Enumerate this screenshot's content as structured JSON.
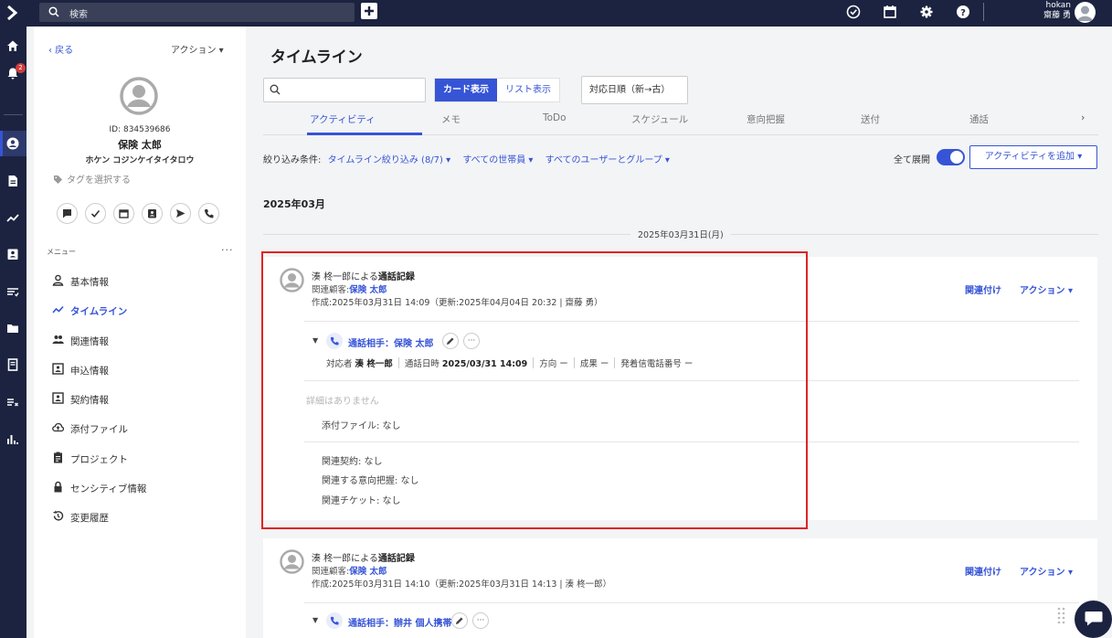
{
  "topbar": {
    "search_placeholder": "検索",
    "user_line1": "hokan",
    "user_line2": "齋藤 勇",
    "icons": [
      "logo-chevron-icon",
      "search-icon",
      "plus-icon",
      "check-circle-icon",
      "calendar-icon",
      "gear-icon",
      "help-icon",
      "user-avatar-icon"
    ]
  },
  "rail": {
    "notification_count": "2",
    "items": [
      "home-icon",
      "bell-icon",
      "customer-icon",
      "document-icon",
      "chart-icon",
      "contact-card-icon",
      "list-icon",
      "folder-icon",
      "book-icon",
      "task-list-icon",
      "bar-chart-icon"
    ]
  },
  "customer": {
    "back": "‹ 戻る",
    "action": "アクション ▾",
    "id": "ID: 834539686",
    "name": "保険 太郎",
    "kana": "ホケン コジンケイタイタロウ",
    "tag_select": "タグを選択する",
    "menu_label": "メニュー",
    "menu_more": "···",
    "menu": [
      {
        "label": "基本情報",
        "icon": "person-icon"
      },
      {
        "label": "タイムライン",
        "icon": "timeline-icon"
      },
      {
        "label": "関連情報",
        "icon": "people-icon"
      },
      {
        "label": "申込情報",
        "icon": "id-card-icon"
      },
      {
        "label": "契約情報",
        "icon": "contract-icon"
      },
      {
        "label": "添付ファイル",
        "icon": "cloud-upload-icon"
      },
      {
        "label": "プロジェクト",
        "icon": "clipboard-icon"
      },
      {
        "label": "センシティブ情報",
        "icon": "lock-icon"
      },
      {
        "label": "変更履歴",
        "icon": "history-icon"
      }
    ]
  },
  "main": {
    "title": "タイムライン",
    "view_card": "カード表示",
    "view_list": "リスト表示",
    "sort": "対応日順（新→古）",
    "tabs": [
      "アクティビティ",
      "メモ",
      "ToDo",
      "スケジュール",
      "意向把握",
      "送付",
      "通話"
    ],
    "tab_more": "›",
    "filter_label": "絞り込み条件:",
    "filters": [
      "タイムライン絞り込み (8/7) ▾",
      "すべての世帯員 ▾",
      "すべてのユーザーとグループ ▾"
    ],
    "expand_all": "全て展開",
    "add_activity": "アクティビティを追加 ▾",
    "month": "2025年03月",
    "date": "2025年03月31日(月)"
  },
  "cards": [
    {
      "title_prefix": "湊 柊一郎による",
      "title_kind": "通話記録",
      "rel_prefix": "関連顧客:",
      "rel_name": "保険 太郎",
      "meta": "作成:2025年03月31日 14:09（更新:2025年04月04日 20:32 | 齋藤 勇）",
      "link": "関連付け",
      "action": "アクション ▾",
      "call_title": "通話相手：保険 太郎",
      "call_more": "···",
      "detail_responder_label": "対応者",
      "detail_responder": "湊 柊一郎",
      "detail_time_label": "通話日時",
      "detail_time": "2025/03/31 14:09",
      "detail_dir": "方向 ー",
      "detail_result": "成果 ー",
      "detail_phone": "発着信電話番号 ー",
      "no_detail": "詳細はありません",
      "attachment": "添付ファイル: なし",
      "rel_contract": "関連契約: なし",
      "rel_intent": "関連する意向把握: なし",
      "rel_ticket": "関連チケット: なし"
    },
    {
      "title_prefix": "湊 柊一郎による",
      "title_kind": "通話記録",
      "rel_prefix": "関連顧客:",
      "rel_name": "保険 太郎",
      "meta": "作成:2025年03月31日 14:10（更新:2025年03月31日 14:13 | 湊 柊一郎）",
      "link": "関連付け",
      "action": "アクション ▾",
      "call_title": "通話相手：辦井 個人携帯",
      "call_more": "···"
    }
  ]
}
